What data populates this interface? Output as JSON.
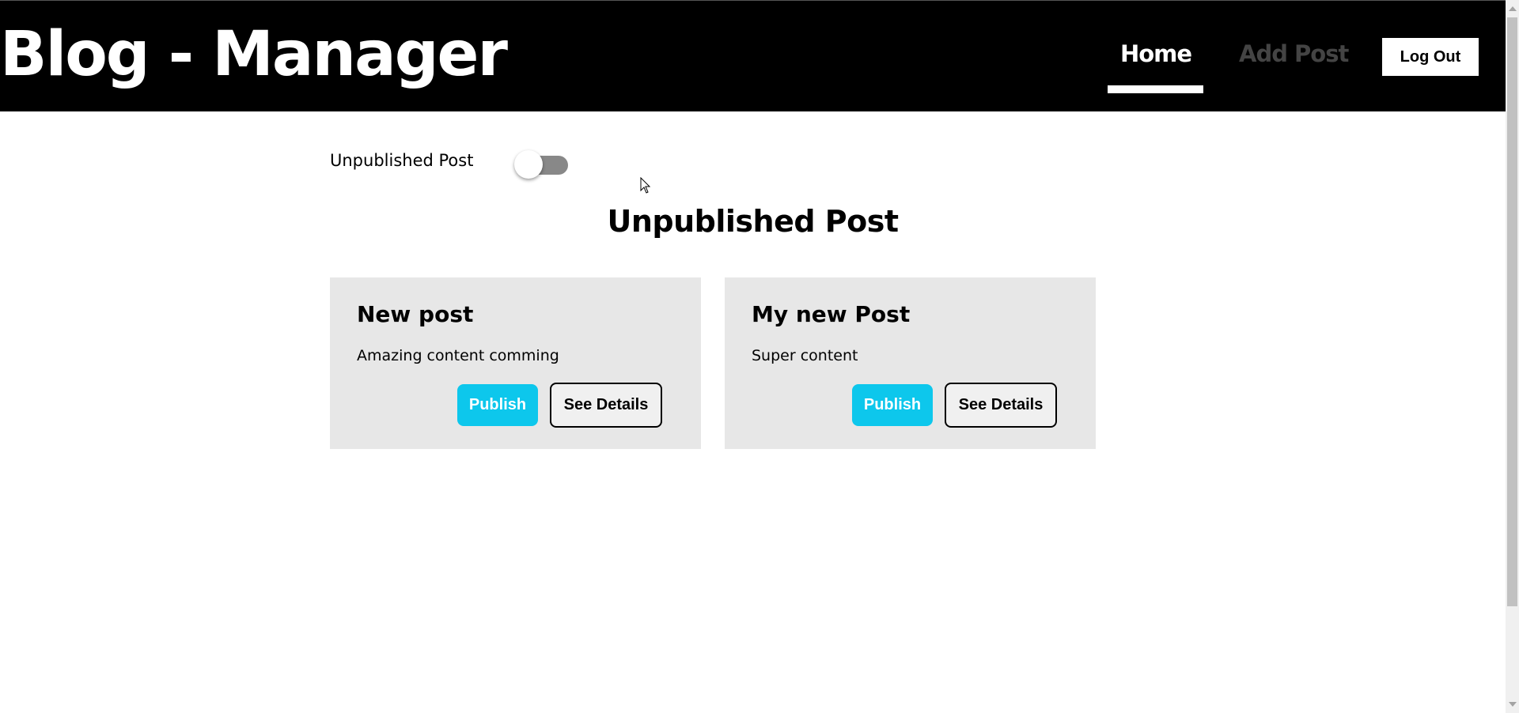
{
  "header": {
    "title": "Blog - Manager",
    "nav": [
      {
        "label": "Home",
        "active": true
      },
      {
        "label": "Add Post",
        "active": false
      }
    ],
    "logout_label": "Log Out"
  },
  "filter": {
    "toggle_label": "Unpublished Post",
    "toggle_on": false
  },
  "main": {
    "heading": "Unpublished Post",
    "posts": [
      {
        "title": "New post",
        "content": "Amazing content comming",
        "publish_label": "Publish",
        "details_label": "See Details"
      },
      {
        "title": "My new Post",
        "content": "Super content",
        "publish_label": "Publish",
        "details_label": "See Details"
      }
    ]
  },
  "colors": {
    "header_bg": "#000000",
    "publish": "#0dc7ec",
    "card_bg": "#e7e7e7",
    "inactive_nav": "#444444"
  }
}
